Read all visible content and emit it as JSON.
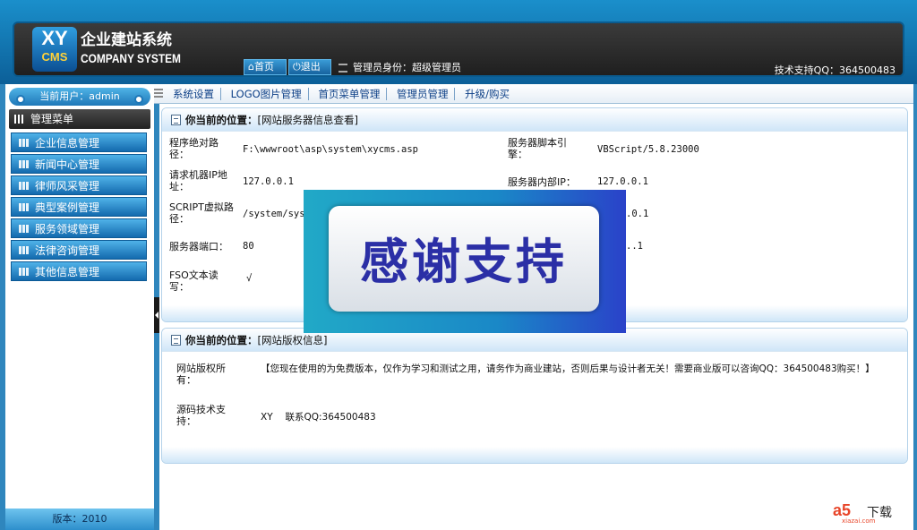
{
  "header": {
    "logo_top": "XY",
    "logo_bottom": "CMS",
    "system_name_cn": "企业建站系统",
    "system_name_en": "COMPANY SYSTEM",
    "home_label": "首页",
    "exit_label": "退出",
    "admin_identity": "管理员身份：超级管理员",
    "tech_support": "技术支持QQ：364500483"
  },
  "sidebar": {
    "current_user": "当前用户：admin",
    "menu_title": "管理菜单",
    "items": [
      {
        "label": "企业信息管理"
      },
      {
        "label": "新闻中心管理"
      },
      {
        "label": "律师风采管理"
      },
      {
        "label": "典型案例管理"
      },
      {
        "label": "服务领域管理"
      },
      {
        "label": "法律咨询管理"
      },
      {
        "label": "其他信息管理"
      }
    ],
    "version": "版本：2010"
  },
  "topnav": {
    "items": [
      {
        "label": "系统设置"
      },
      {
        "label": "LOGO图片管理"
      },
      {
        "label": "首页菜单管理"
      },
      {
        "label": "管理员管理"
      },
      {
        "label": "升级/购买"
      }
    ]
  },
  "server_panel": {
    "location_label": "你当前的位置：",
    "location_value": "[网站服务器信息查看]",
    "rows": [
      {
        "l1": "程序绝对路径：",
        "v1": "F:\\wwwroot\\asp\\system\\xycms.asp",
        "l2": "服务器脚本引擎：",
        "v2": "VBScript/5.8.23000"
      },
      {
        "l1": "请求机器IP地址：",
        "v1": "127.0.0.1",
        "l2": "服务器内部IP：",
        "v2": "127.0.0.1"
      },
      {
        "l1": "SCRIPT虚拟路径：",
        "v1": "/system/sys",
        "l2": "",
        "v2": ".0.1"
      },
      {
        "l1": "服务器端口：",
        "v1": "80",
        "l2": "",
        "v2": "..1"
      },
      {
        "l1": "FSO文本读写：",
        "v1": "√",
        "l2": "",
        "v2": ""
      }
    ]
  },
  "copyright_panel": {
    "location_label": "你当前的位置：",
    "location_value": "[网站版权信息]",
    "rows": [
      {
        "label": "网站版权所有：",
        "value": "【您现在使用的为免费版本，仅作为学习和测试之用，请务作为商业建站，否则后果与设计者无关！需要商业版可以咨询QQ：364500483购买！】"
      },
      {
        "label": "源码技术支持：",
        "value": "XY　 联系QQ:364500483"
      }
    ]
  },
  "overlay": {
    "text": "感谢支持"
  },
  "watermark": {
    "logo": "a5",
    "cn": "下载",
    "url": "xiazai.com"
  }
}
